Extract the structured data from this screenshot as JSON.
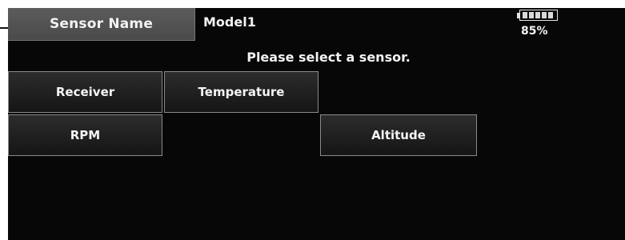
{
  "header": {
    "title": "Sensor Name",
    "model_name": "Model1",
    "battery": {
      "level_percent": 85,
      "label": "85%",
      "cells_filled": 5
    }
  },
  "main": {
    "prompt": "Please select a sensor.",
    "sensors": [
      {
        "label": "Receiver"
      },
      {
        "label": "Temperature"
      },
      {
        "label": "RPM"
      },
      {
        "label": "Altitude"
      }
    ]
  },
  "colors": {
    "screen_background": "#070707",
    "title_tab_background": "#555555",
    "button_border": "#8a8a8a",
    "text": "#f2f2f2"
  }
}
